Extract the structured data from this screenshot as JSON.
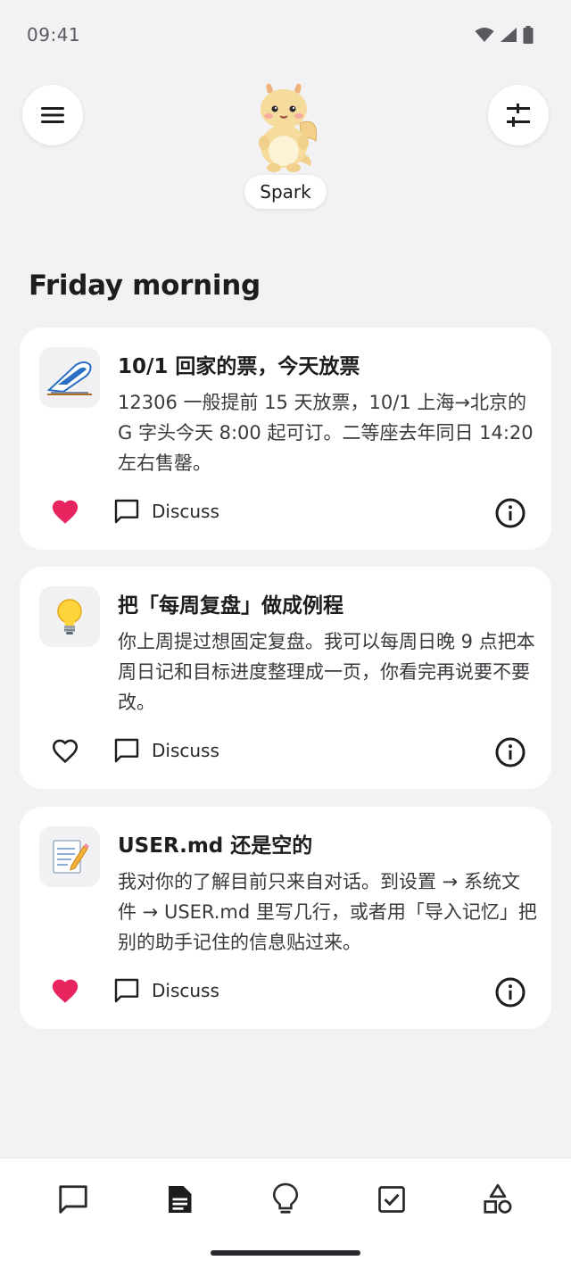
{
  "status": {
    "time": "09:41"
  },
  "header": {
    "menu_icon": "hamburger-menu-icon",
    "filter_icon": "sliders-icon",
    "mascot_name": "Spark"
  },
  "greeting": "Friday morning",
  "cards": [
    {
      "icon": "train-icon",
      "title": "10/1 回家的票，今天放票",
      "body": "12306 一般提前 15 天放票，10/1 上海→北京的 G 字头今天 8:00 起可订。二等座去年同日 14:20 左右售罄。",
      "liked": true,
      "discuss_label": "Discuss"
    },
    {
      "icon": "lightbulb-icon",
      "title": "把「每周复盘」做成例程",
      "body": "你上周提过想固定复盘。我可以每周日晚 9 点把本周日记和目标进度整理成一页，你看完再说要不要改。",
      "liked": false,
      "discuss_label": "Discuss"
    },
    {
      "icon": "memo-icon",
      "title": "USER.md 还是空的",
      "body": "我对你的了解目前只来自对话。到设置 → 系统文件 → USER.md 里写几行，或者用「导入记忆」把别的助手记住的信息贴过来。",
      "liked": true,
      "discuss_label": "Discuss"
    }
  ],
  "colors": {
    "heart": "#e8245f",
    "background": "#f2f2f4",
    "card": "#ffffff"
  },
  "bottom_nav": [
    {
      "icon": "chat-icon",
      "active": false
    },
    {
      "icon": "document-icon",
      "active": true
    },
    {
      "icon": "lightbulb-icon",
      "active": false
    },
    {
      "icon": "checkbox-icon",
      "active": false
    },
    {
      "icon": "shapes-icon",
      "active": false
    }
  ]
}
